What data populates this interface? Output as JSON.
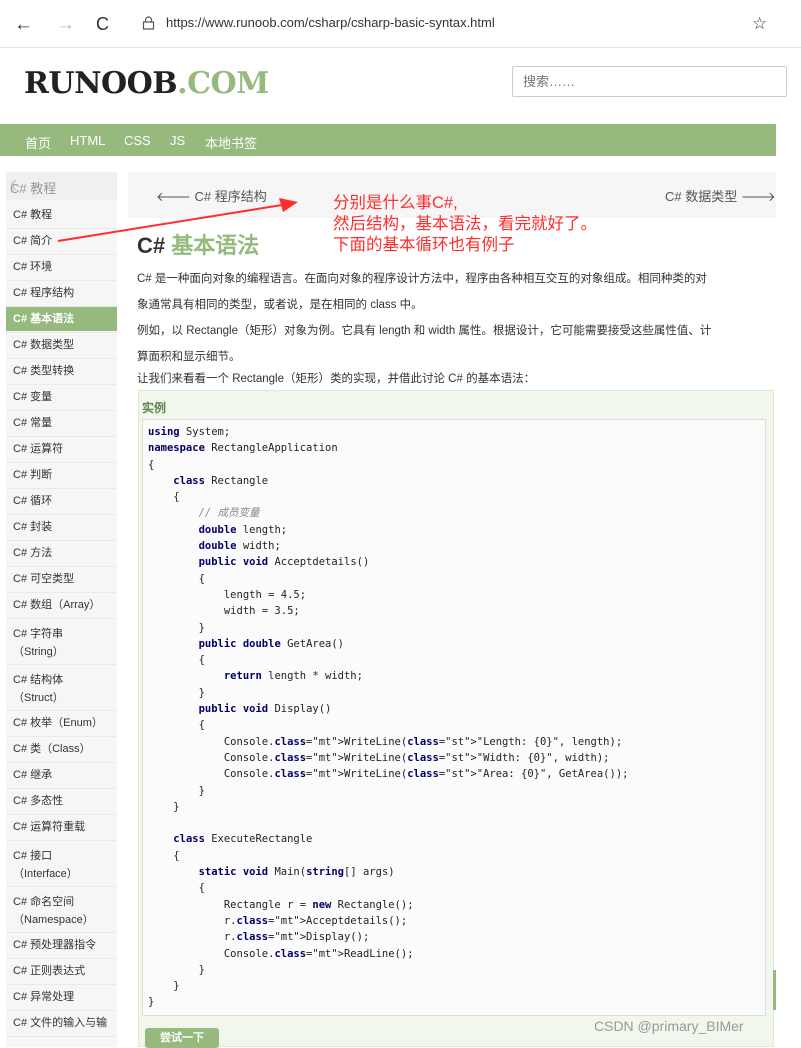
{
  "browser": {
    "url": "https://www.runoob.com/csharp/csharp-basic-syntax.html",
    "back_glyph": "←",
    "forward_glyph": "→",
    "reload_glyph": "C",
    "fav_glyph": "☆"
  },
  "site": {
    "logo_main": "RUNOOB",
    "logo_com": ".COM",
    "search_placeholder": "搜索……",
    "nav": [
      "首页",
      "HTML",
      "CSS",
      "JS",
      "本地书签"
    ]
  },
  "sidebar": {
    "heading": "C# 教程",
    "items": [
      "C# 教程",
      "C# 简介",
      "C# 环境",
      "C# 程序结构",
      "C# 基本语法",
      "C# 数据类型",
      "C# 类型转换",
      "C# 变量",
      "C# 常量",
      "C# 运算符",
      "C# 判断",
      "C# 循环",
      "C# 封装",
      "C# 方法",
      "C# 可空类型",
      "C# 数组（Array）",
      "C# 字符串\n（String）",
      "C# 结构体\n（Struct）",
      "C# 枚举（Enum）",
      "C# 类（Class）",
      "C# 继承",
      "C# 多态性",
      "C# 运算符重载",
      "C# 接口\n（Interface）",
      "C# 命名空间\n（Namespace）",
      "C# 预处理器指令",
      "C# 正则表达式",
      "C# 异常处理",
      "C# 文件的输入与输"
    ],
    "active_index": 4
  },
  "content": {
    "prev": "C# 程序结构",
    "next": "C# 数据类型",
    "title_prefix": "C#",
    "title_main": "基本语法",
    "para1_line1": "C# 是一种面向对象的编程语言。在面向对象的程序设计方法中，程序由各种相互交互的对象组成。相同种类的对",
    "para1_line2": "象通常具有相同的类型，或者说，是在相同的 class 中。",
    "para2_line1": "例如，以 Rectangle（矩形）对象为例。它具有 length 和 width 属性。根据设计，它可能需要接受这些属性值、计",
    "para2_line2": "算面积和显示细节。",
    "para3": "让我们来看看一个 Rectangle（矩形）类的实现，并借此讨论 C# 的基本语法：",
    "example_label": "实例",
    "try_button": "尝试一下"
  },
  "code": [
    "using System;",
    "namespace RectangleApplication",
    "{",
    "    class Rectangle",
    "    {",
    "        // 成员变量",
    "        double length;",
    "        double width;",
    "        public void Acceptdetails()",
    "        {",
    "            length = 4.5;",
    "            width = 3.5;",
    "        }",
    "        public double GetArea()",
    "        {",
    "            return length * width;",
    "        }",
    "        public void Display()",
    "        {",
    "            Console.WriteLine(\"Length: {0}\", length);",
    "            Console.WriteLine(\"Width: {0}\", width);",
    "            Console.WriteLine(\"Area: {0}\", GetArea());",
    "        }",
    "    }",
    "",
    "    class ExecuteRectangle",
    "    {",
    "        static void Main(string[] args)",
    "        {",
    "            Rectangle r = new Rectangle();",
    "            r.Acceptdetails();",
    "            r.Display();",
    "            Console.ReadLine();",
    "        }",
    "    }",
    "}"
  ],
  "annotation": {
    "line1": "分别是什么事C#,",
    "line2": "然后结构，基本语法，看完就好了。",
    "line3": "下面的基本循环也有例子",
    "color": "#ff2d2d"
  },
  "watermark": "CSDN @primary_BIMer",
  "colors": {
    "brand_green": "#96b97d",
    "annotation_red": "#ff2d2d"
  }
}
